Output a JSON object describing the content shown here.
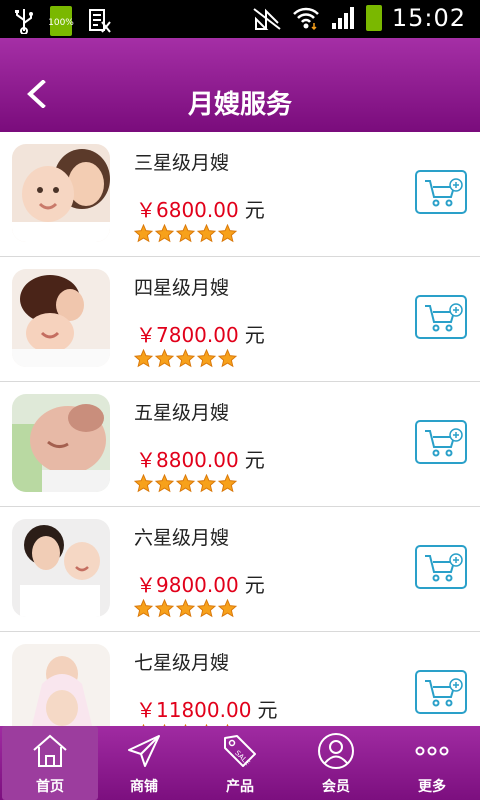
{
  "status_bar": {
    "time": "15:02",
    "battery_small": "100%"
  },
  "header": {
    "title": "月嫂服务"
  },
  "colors": {
    "brand": "#8e1b8f",
    "price": "#e1001a",
    "cart_border": "#2aa0c9",
    "star": "#f7a11b"
  },
  "products": [
    {
      "name": "三星级月嫂",
      "price": "￥6800.00",
      "unit": "元",
      "rating": 5
    },
    {
      "name": "四星级月嫂",
      "price": "￥7800.00",
      "unit": "元",
      "rating": 5
    },
    {
      "name": "五星级月嫂",
      "price": "￥8800.00",
      "unit": "元",
      "rating": 5
    },
    {
      "name": "六星级月嫂",
      "price": "￥9800.00",
      "unit": "元",
      "rating": 5
    },
    {
      "name": "七星级月嫂",
      "price": "￥11800.00",
      "unit": "元",
      "rating": 5
    }
  ],
  "tabs": [
    {
      "label": "首页",
      "icon": "home-icon"
    },
    {
      "label": "商铺",
      "icon": "paper-plane-icon"
    },
    {
      "label": "产品",
      "icon": "sale-tag-icon"
    },
    {
      "label": "会员",
      "icon": "user-icon"
    },
    {
      "label": "更多",
      "icon": "more-dots-icon"
    }
  ]
}
